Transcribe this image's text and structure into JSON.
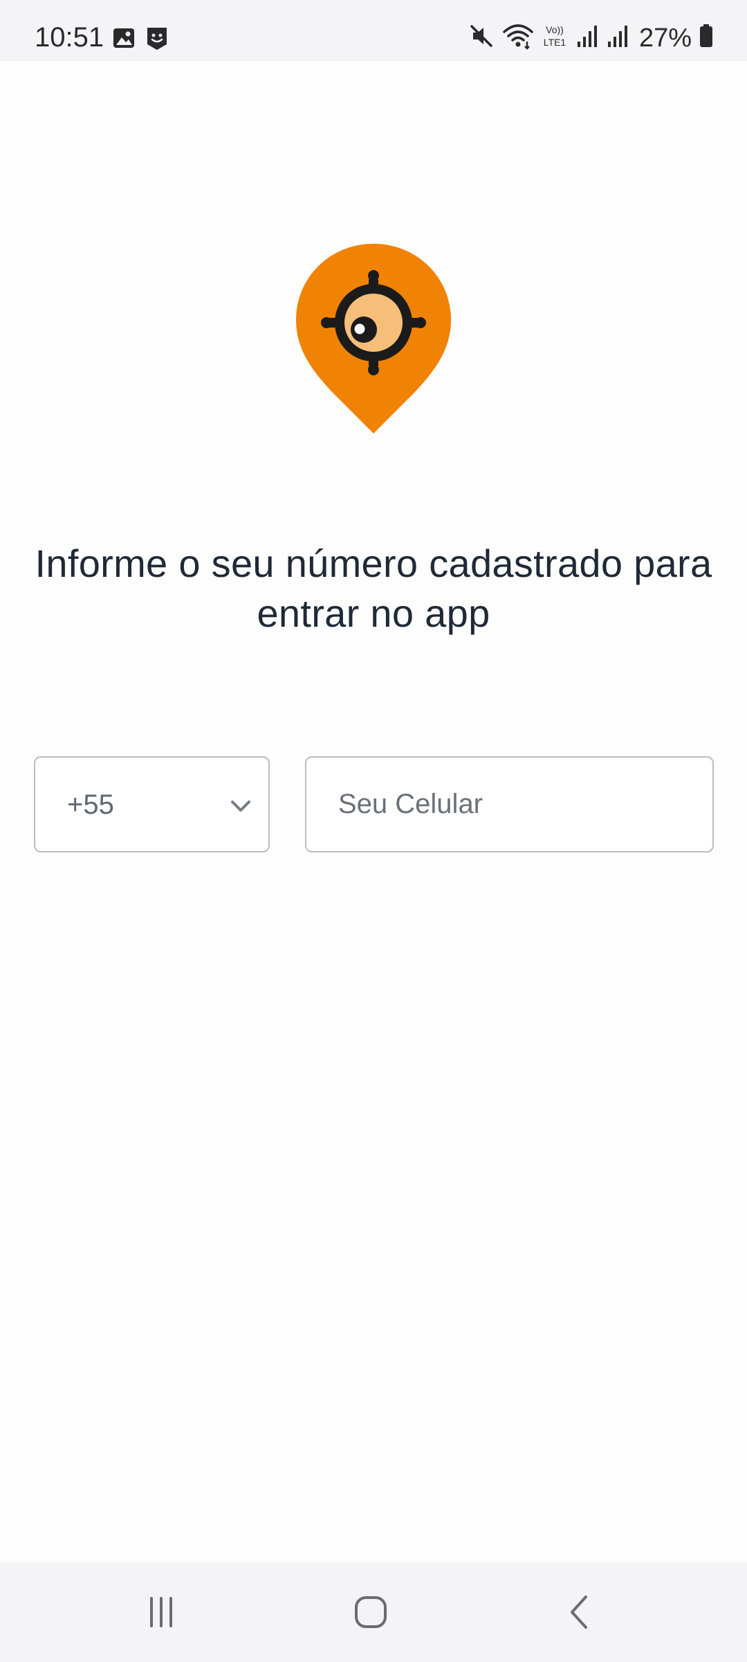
{
  "status_bar": {
    "time": "10:51",
    "battery_percent": "27%",
    "network_label": "VoLTE1",
    "left_icons": [
      "gallery-icon",
      "app-notification-icon"
    ],
    "right_icons": [
      "mute-icon",
      "wifi-icon",
      "volte-icon",
      "signal-icon",
      "signal-icon",
      "battery-icon"
    ]
  },
  "logo": {
    "icon": "location-pin-eye-icon",
    "colors": {
      "pin": "#f08204",
      "ring": "#1b1b1b",
      "iris": "#f6bf79",
      "pupil": "#1b1b1b",
      "highlight": "#ffffff"
    }
  },
  "login": {
    "title": "Informe o seu número cadastrado para entrar no app",
    "country_code": "+55",
    "phone_value": "",
    "phone_placeholder": "Seu Celular"
  },
  "navigation": {
    "buttons": [
      "recent-apps-icon",
      "home-icon",
      "back-icon"
    ]
  }
}
